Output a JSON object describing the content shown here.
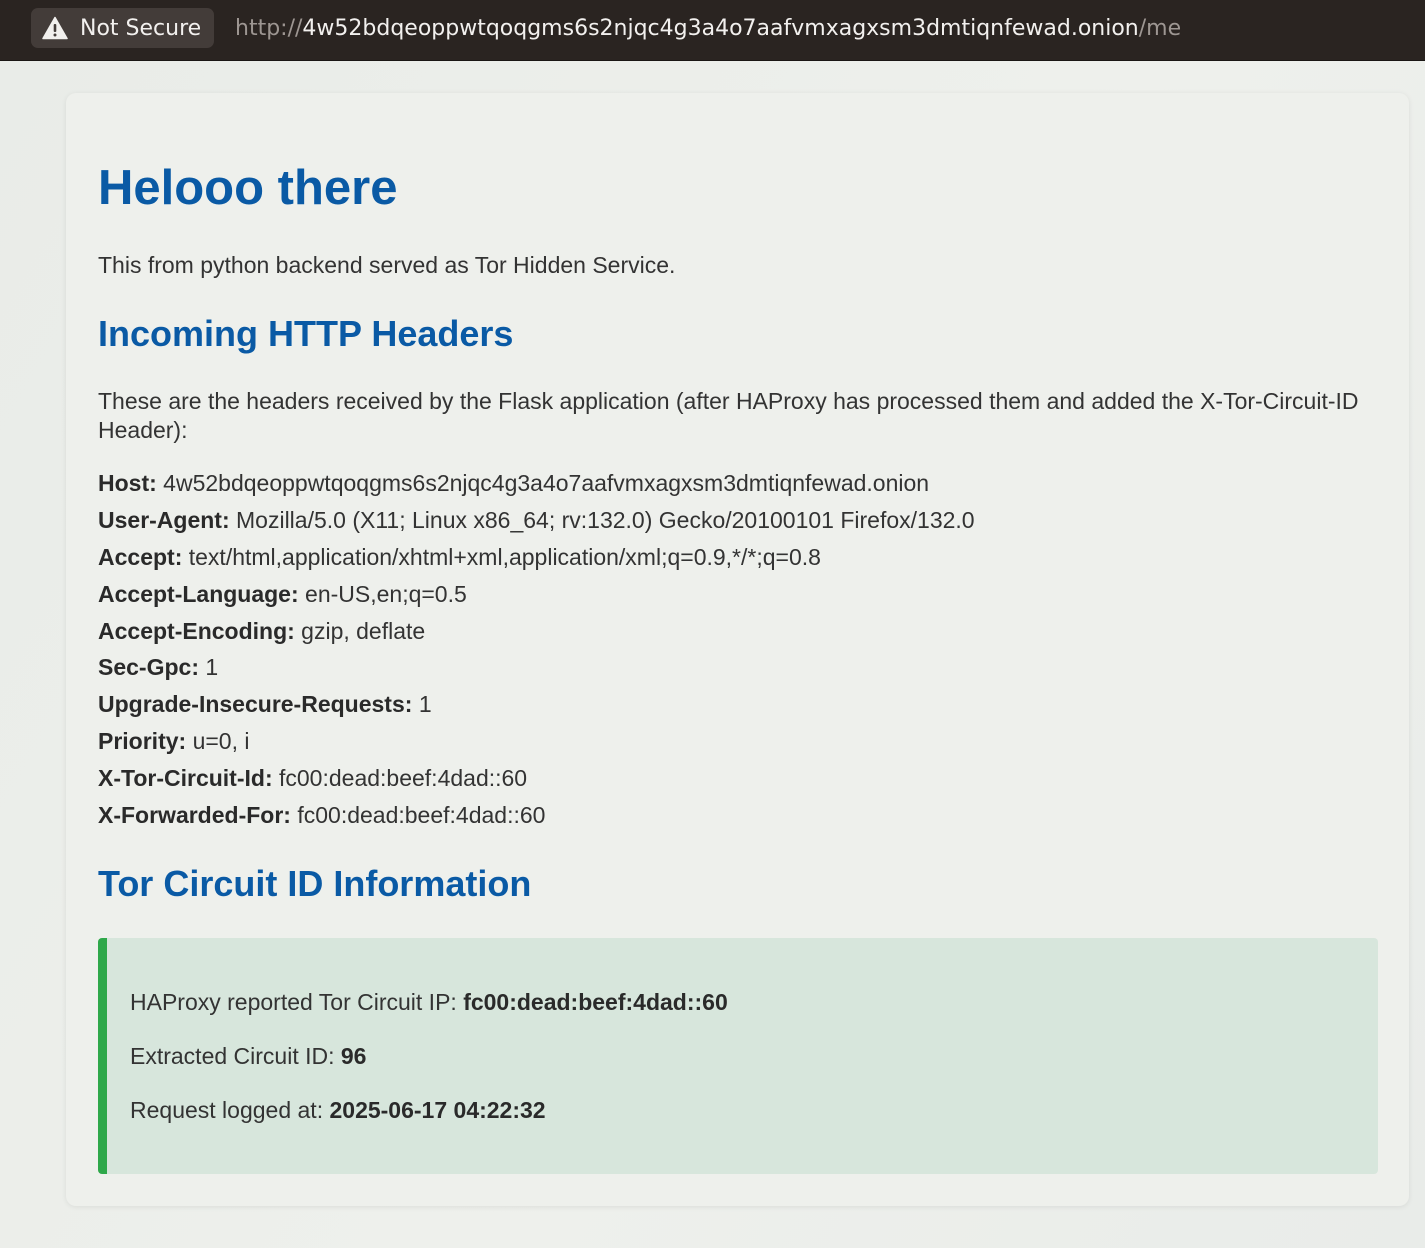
{
  "browser": {
    "security_label": "Not Secure",
    "security_icon": "warning-triangle-icon",
    "url": {
      "scheme": "http://",
      "host": "4w52bdqeoppwtqoqgms6s2njqc4g3a4o7aafvmxagxsm3dmtiqnfewad.onion",
      "path": "/me"
    }
  },
  "page": {
    "title": "Helooo there",
    "intro": "This from python backend served as Tor Hidden Service.",
    "headers_section": {
      "heading": "Incoming HTTP Headers",
      "description": "These are the headers received by the Flask application (after HAProxy has processed them and added the X-Tor-Circuit-ID Header):",
      "items": [
        {
          "name": "Host:",
          "value": "4w52bdqeoppwtqoqgms6s2njqc4g3a4o7aafvmxagxsm3dmtiqnfewad.onion"
        },
        {
          "name": "User-Agent:",
          "value": "Mozilla/5.0 (X11; Linux x86_64; rv:132.0) Gecko/20100101 Firefox/132.0"
        },
        {
          "name": "Accept:",
          "value": "text/html,application/xhtml+xml,application/xml;q=0.9,*/*;q=0.8"
        },
        {
          "name": "Accept-Language:",
          "value": "en-US,en;q=0.5"
        },
        {
          "name": "Accept-Encoding:",
          "value": "gzip, deflate"
        },
        {
          "name": "Sec-Gpc:",
          "value": "1"
        },
        {
          "name": "Upgrade-Insecure-Requests:",
          "value": "1"
        },
        {
          "name": "Priority:",
          "value": "u=0, i"
        },
        {
          "name": "X-Tor-Circuit-Id:",
          "value": "fc00:dead:beef:4dad::60"
        },
        {
          "name": "X-Forwarded-For:",
          "value": "fc00:dead:beef:4dad::60"
        }
      ]
    },
    "circuit_section": {
      "heading": "Tor Circuit ID Information",
      "ip_label": "HAProxy reported Tor Circuit IP:",
      "ip_value": "fc00:dead:beef:4dad::60",
      "id_label": "Extracted Circuit ID:",
      "id_value": "96",
      "logged_label": "Request logged at:",
      "logged_value": "2025-06-17 04:22:32"
    }
  },
  "colors": {
    "heading": "#0a5aa5",
    "accent_bar": "#2ea84a",
    "info_box_bg": "#d7e6dc",
    "toolbar_bg": "#2a2421"
  }
}
